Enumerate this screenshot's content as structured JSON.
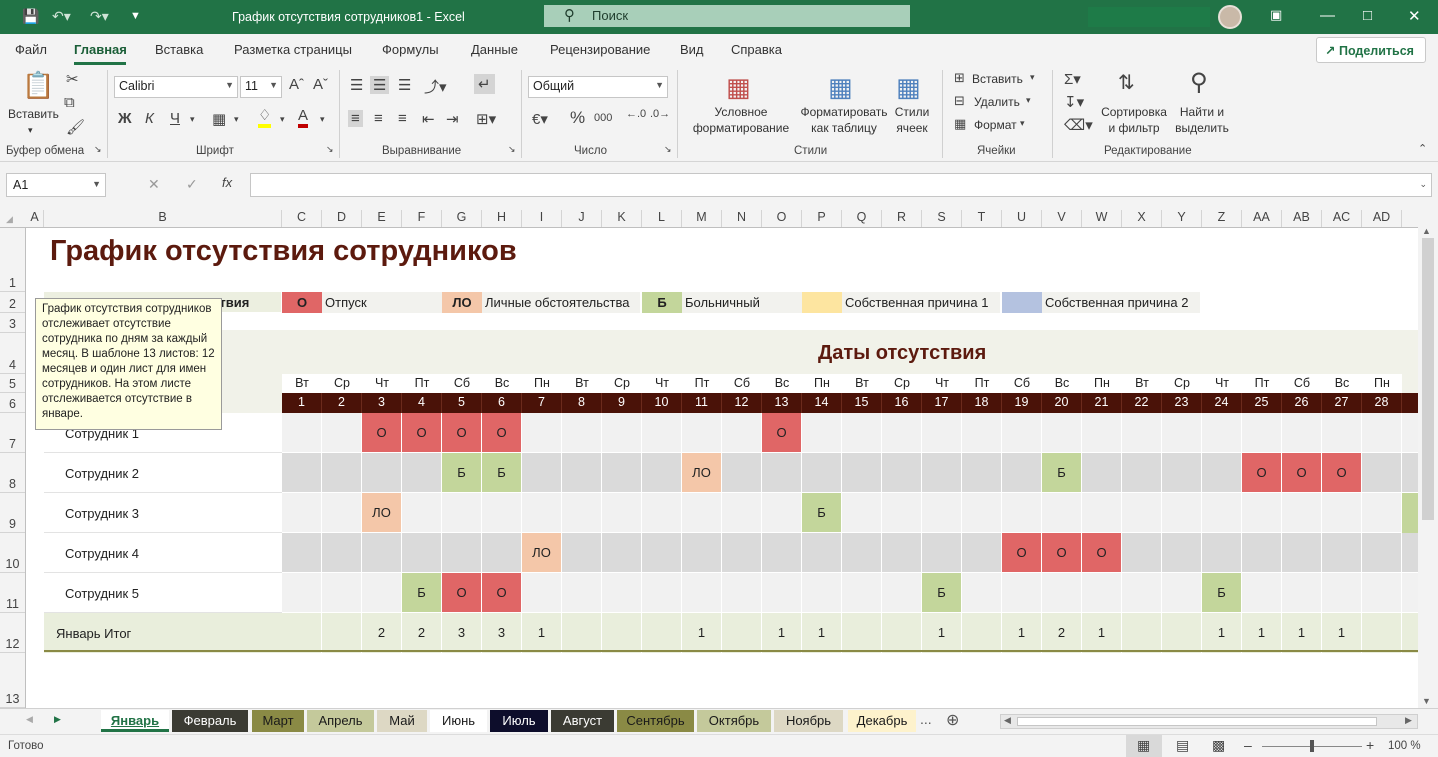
{
  "window": {
    "title": "График отсутствия сотрудников1  -  Excel",
    "search_placeholder": "Поиск"
  },
  "menu_tabs": [
    "Файл",
    "Главная",
    "Вставка",
    "Разметка страницы",
    "Формулы",
    "Данные",
    "Рецензирование",
    "Вид",
    "Справка"
  ],
  "share_label": "Поделиться",
  "ribbon": {
    "paste": "Вставить",
    "clipboard": "Буфер обмена",
    "font_name": "Calibri",
    "font_size": "11",
    "bold": "Ж",
    "italic": "К",
    "underline": "Ч",
    "font_group": "Шрифт",
    "align_group": "Выравнивание",
    "number_format": "Общий",
    "number_group": "Число",
    "cond_format": "Условное форматирование",
    "format_table": "Форматировать как таблицу",
    "cell_styles": "Стили ячеек",
    "styles_group": "Стили",
    "insert": "Вставить",
    "delete": "Удалить",
    "format": "Формат",
    "cells_group": "Ячейки",
    "sort_filter": "Сортировка и фильтр",
    "find_select": "Найти и выделить",
    "editing_group": "Редактирование"
  },
  "name_box": "A1",
  "fx": "fx",
  "columns": [
    "A",
    "B",
    "C",
    "D",
    "E",
    "F",
    "G",
    "H",
    "I",
    "J",
    "K",
    "L",
    "M",
    "N",
    "O",
    "P",
    "Q",
    "R",
    "S",
    "T",
    "U",
    "V",
    "W",
    "X",
    "Y",
    "Z",
    "AA",
    "AB",
    "AC",
    "AD"
  ],
  "rows": [
    "1",
    "2",
    "3",
    "4",
    "5",
    "6",
    "7",
    "8",
    "9",
    "10",
    "11",
    "12",
    "13"
  ],
  "sheet": {
    "title": "График отсутствия сотрудников",
    "legend_head": "тствия",
    "legend": [
      {
        "code": "О",
        "label": "Отпуск",
        "color": "#e06666"
      },
      {
        "code": "ЛО",
        "label": "Личные обстоятельства",
        "color": "#f4c7a9"
      },
      {
        "code": "Б",
        "label": "Больничный",
        "color": "#c3d69b"
      },
      {
        "code": "",
        "label": "Собственная причина 1",
        "color": "#fde5a0"
      },
      {
        "code": "",
        "label": "Собственная причина 2",
        "color": "#b4c2e0"
      }
    ],
    "dates_header": "Даты отсутствия",
    "weekdays": [
      "Вт",
      "Ср",
      "Чт",
      "Пт",
      "Сб",
      "Вс",
      "Пн",
      "Вт",
      "Ср",
      "Чт",
      "Пт",
      "Сб",
      "Вс",
      "Пн",
      "Вт",
      "Ср",
      "Чт",
      "Пт",
      "Сб",
      "Вс",
      "Пн",
      "Вт",
      "Ср",
      "Чт",
      "Пт",
      "Сб",
      "Вс",
      "Пн"
    ],
    "days": [
      "1",
      "2",
      "3",
      "4",
      "5",
      "6",
      "7",
      "8",
      "9",
      "10",
      "11",
      "12",
      "13",
      "14",
      "15",
      "16",
      "17",
      "18",
      "19",
      "20",
      "21",
      "22",
      "23",
      "24",
      "25",
      "26",
      "27",
      "28"
    ],
    "employees": [
      {
        "name": "Сотрудник 1",
        "marks": {
          "3": "О",
          "4": "О",
          "5": "О",
          "6": "О",
          "13": "О"
        }
      },
      {
        "name": "Сотрудник 2",
        "marks": {
          "5": "Б",
          "6": "Б",
          "11": "ЛО",
          "20": "Б",
          "25": "О",
          "26": "О",
          "27": "О"
        }
      },
      {
        "name": "Сотрудник 3",
        "marks": {
          "3": "ЛО",
          "14": "Б"
        }
      },
      {
        "name": "Сотрудник 4",
        "marks": {
          "7": "ЛО",
          "19": "О",
          "20": "О",
          "21": "О"
        }
      },
      {
        "name": "Сотрудник 5",
        "marks": {
          "4": "Б",
          "5": "О",
          "6": "О",
          "17": "Б",
          "24": "Б"
        }
      }
    ],
    "total_label": "Январь Итог",
    "totals": {
      "3": "2",
      "4": "2",
      "5": "3",
      "6": "3",
      "7": "1",
      "11": "1",
      "13": "1",
      "14": "1",
      "17": "1",
      "19": "1",
      "20": "2",
      "21": "1",
      "24": "1",
      "25": "1",
      "26": "1",
      "27": "1"
    }
  },
  "tooltip": "График отсутствия сотрудников отслеживает отсутствие сотрудника по дням за каждый месяц. В шаблоне 13 листов: 12 месяцев и один лист для имен сотрудников. На этом листе отслеживается отсутствие в январе.",
  "sheet_tabs": [
    {
      "label": "Январь",
      "bg": "#ffffff",
      "fg": "#217346",
      "active": true
    },
    {
      "label": "Февраль",
      "bg": "#3b3b33",
      "fg": "#ffffff"
    },
    {
      "label": "Март",
      "bg": "#8a8a45",
      "fg": "#1a1a1a"
    },
    {
      "label": "Апрель",
      "bg": "#c4c99b",
      "fg": "#1a1a1a"
    },
    {
      "label": "Май",
      "bg": "#ddd8c4",
      "fg": "#1a1a1a"
    },
    {
      "label": "Июнь",
      "bg": "#ffffff",
      "fg": "#1a1a1a"
    },
    {
      "label": "Июль",
      "bg": "#0d0d2b",
      "fg": "#ffffff"
    },
    {
      "label": "Август",
      "bg": "#3b3b33",
      "fg": "#ffffff"
    },
    {
      "label": "Сентябрь",
      "bg": "#8a8a45",
      "fg": "#1a1a1a"
    },
    {
      "label": "Октябрь",
      "bg": "#c4c99b",
      "fg": "#1a1a1a"
    },
    {
      "label": "Ноябрь",
      "bg": "#ddd8c4",
      "fg": "#1a1a1a"
    },
    {
      "label": "Декабрь",
      "bg": "#fdf2cc",
      "fg": "#1a1a1a"
    }
  ],
  "status": {
    "ready": "Готово",
    "zoom": "100 %"
  },
  "colors": {
    "accent": "#217346",
    "title": "#5c1a0e",
    "day_bar": "#4a1208",
    "light_row": "#f1f1f1",
    "dark_row": "#dadada",
    "total_row": "#e9eedc"
  }
}
